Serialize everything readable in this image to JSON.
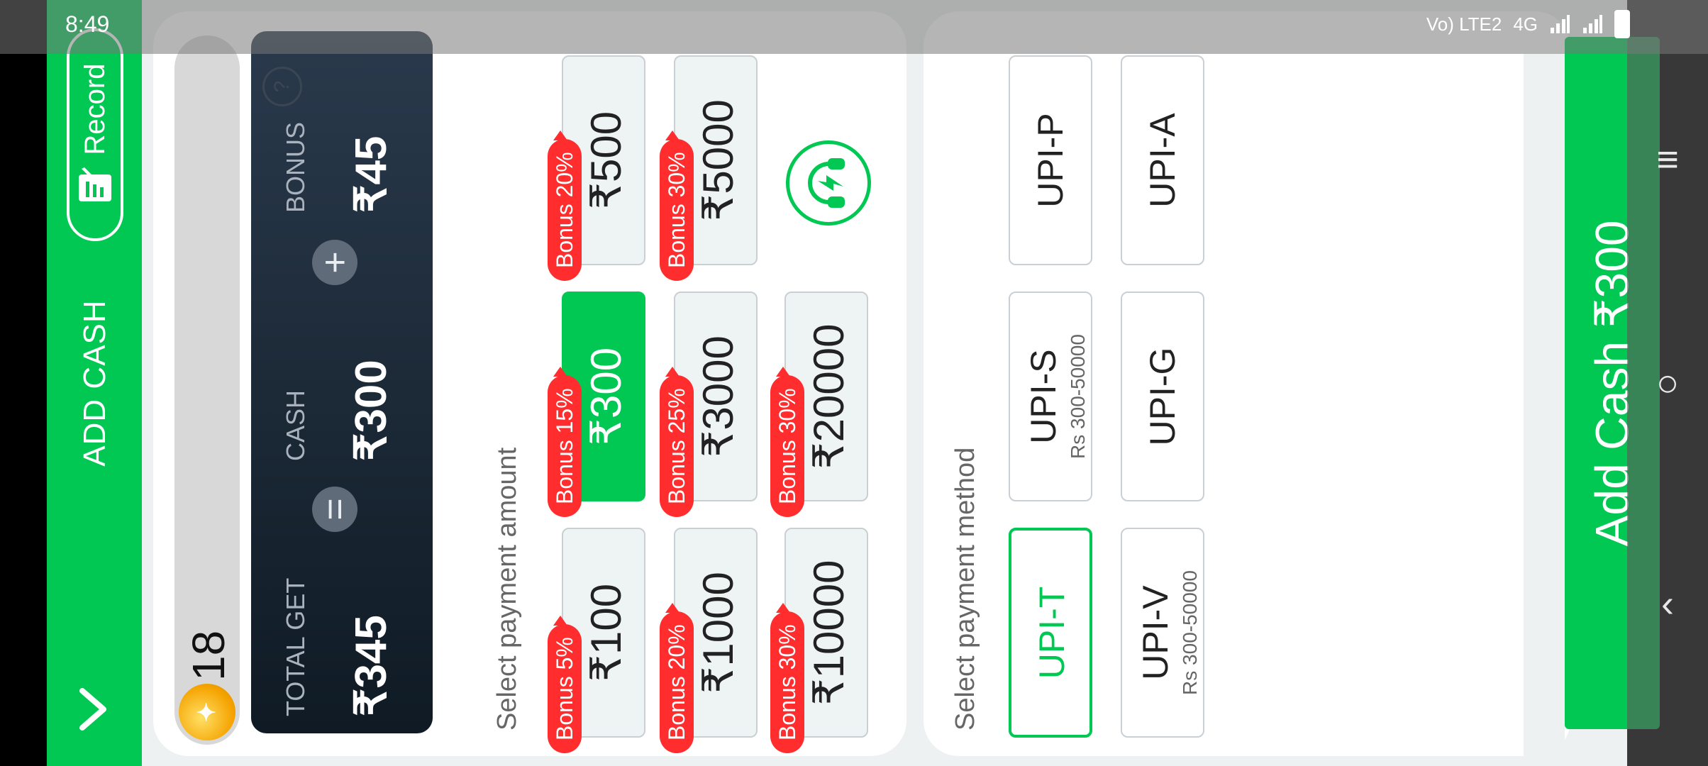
{
  "status_bar": {
    "time": "8:49",
    "network": "Vo) LTE2",
    "network_type": "4G"
  },
  "header": {
    "title": "ADD CASH",
    "record_label": "Record"
  },
  "wallet": {
    "coins": "18",
    "total_label": "TOTAL GET",
    "total_value": "₹345",
    "cash_label": "CASH",
    "cash_value": "₹300",
    "bonus_label": "BONUS",
    "bonus_value": "₹45",
    "equals": "=",
    "plus": "+",
    "help": "?"
  },
  "amount_section": {
    "heading": "Select payment amount",
    "options": [
      {
        "value": "₹100",
        "bonus": "Bonus 5%",
        "selected": false
      },
      {
        "value": "₹300",
        "bonus": "Bonus 15%",
        "selected": true
      },
      {
        "value": "₹500",
        "bonus": "Bonus 20%",
        "selected": false
      },
      {
        "value": "₹1000",
        "bonus": "Bonus 20%",
        "selected": false
      },
      {
        "value": "₹3000",
        "bonus": "Bonus 25%",
        "selected": false
      },
      {
        "value": "₹5000",
        "bonus": "Bonus 30%",
        "selected": false
      },
      {
        "value": "₹10000",
        "bonus": "Bonus 30%",
        "selected": false
      },
      {
        "value": "₹20000",
        "bonus": "Bonus 30%",
        "selected": false
      }
    ]
  },
  "method_section": {
    "heading": "Select payment method",
    "methods": [
      {
        "name": "UPI-T",
        "range": "",
        "selected": true
      },
      {
        "name": "UPI-S",
        "range": "Rs 300-50000",
        "selected": false
      },
      {
        "name": "UPI-P",
        "range": "",
        "selected": false
      },
      {
        "name": "UPI-V",
        "range": "Rs 300-50000",
        "selected": false
      },
      {
        "name": "UPI-G",
        "range": "",
        "selected": false
      },
      {
        "name": "UPI-A",
        "range": "",
        "selected": false
      }
    ]
  },
  "cta": {
    "label": "Add Cash ₹300"
  },
  "colors": {
    "accent": "#00c853",
    "bonus_tag": "#ff2d2d",
    "summary_bg": "#1a2633"
  },
  "icons": {
    "back": "chevron-down-icon",
    "record": "record-icon",
    "coin": "coin-icon",
    "support": "support-headset-icon",
    "nav_menu": "menu-icon",
    "nav_home": "home-circle-icon",
    "nav_back": "back-triangle-icon"
  }
}
